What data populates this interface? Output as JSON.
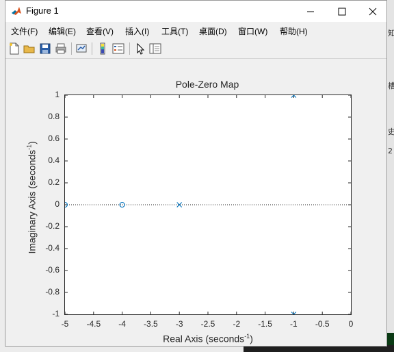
{
  "window": {
    "title": "Figure 1",
    "minimize_glyph": "—",
    "maximize_glyph": "☐",
    "close_glyph": "✕"
  },
  "menu": {
    "items": [
      {
        "label": "文件(F)"
      },
      {
        "label": "编辑(E)"
      },
      {
        "label": "查看(V)"
      },
      {
        "label": "插入(I)"
      },
      {
        "label": "工具(T)"
      },
      {
        "label": "桌面(D)"
      },
      {
        "label": "窗口(W)"
      },
      {
        "label": "帮助(H)"
      }
    ],
    "overflow_glyph": "↘"
  },
  "toolbar": {
    "buttons": [
      {
        "icon": "new-figure-icon"
      },
      {
        "icon": "open-file-icon"
      },
      {
        "icon": "save-icon"
      },
      {
        "icon": "print-icon"
      },
      {
        "icon": "link-plot-icon"
      },
      {
        "icon": "insert-colorbar-icon"
      },
      {
        "icon": "insert-legend-icon"
      },
      {
        "icon": "edit-plot-pointer-icon"
      },
      {
        "icon": "property-inspector-icon"
      }
    ]
  },
  "background": {
    "right_chars": [
      "知",
      "槽",
      "史",
      "2"
    ]
  },
  "chart_data": {
    "type": "scatter",
    "title": "Pole-Zero Map",
    "xlabel_text": "Real Axis (seconds",
    "xlabel_exp": "-1",
    "xlabel_close": ")",
    "ylabel_text": "Imaginary Axis (seconds",
    "ylabel_exp": "-1",
    "ylabel_close": ")",
    "xlim": [
      -5,
      0
    ],
    "ylim": [
      -1,
      1
    ],
    "xticks": [
      "-5",
      "-4.5",
      "-4",
      "-3.5",
      "-3",
      "-2.5",
      "-2",
      "-1.5",
      "-1",
      "-0.5",
      "0"
    ],
    "yticks": [
      "1",
      "0.8",
      "0.6",
      "0.4",
      "0.2",
      "0",
      "-0.2",
      "-0.4",
      "-0.6",
      "-0.8",
      "-1"
    ],
    "grid": false,
    "zero_line": "dotted",
    "series": [
      {
        "kind": "poles",
        "marker": "x",
        "color": "#0072bd",
        "points": [
          [
            -1,
            1
          ],
          [
            -1,
            -1
          ],
          [
            -3,
            0
          ]
        ]
      },
      {
        "kind": "zeros",
        "marker": "o",
        "color": "#0072bd",
        "points": [
          [
            -4,
            0
          ],
          [
            -5,
            0
          ]
        ]
      }
    ]
  }
}
